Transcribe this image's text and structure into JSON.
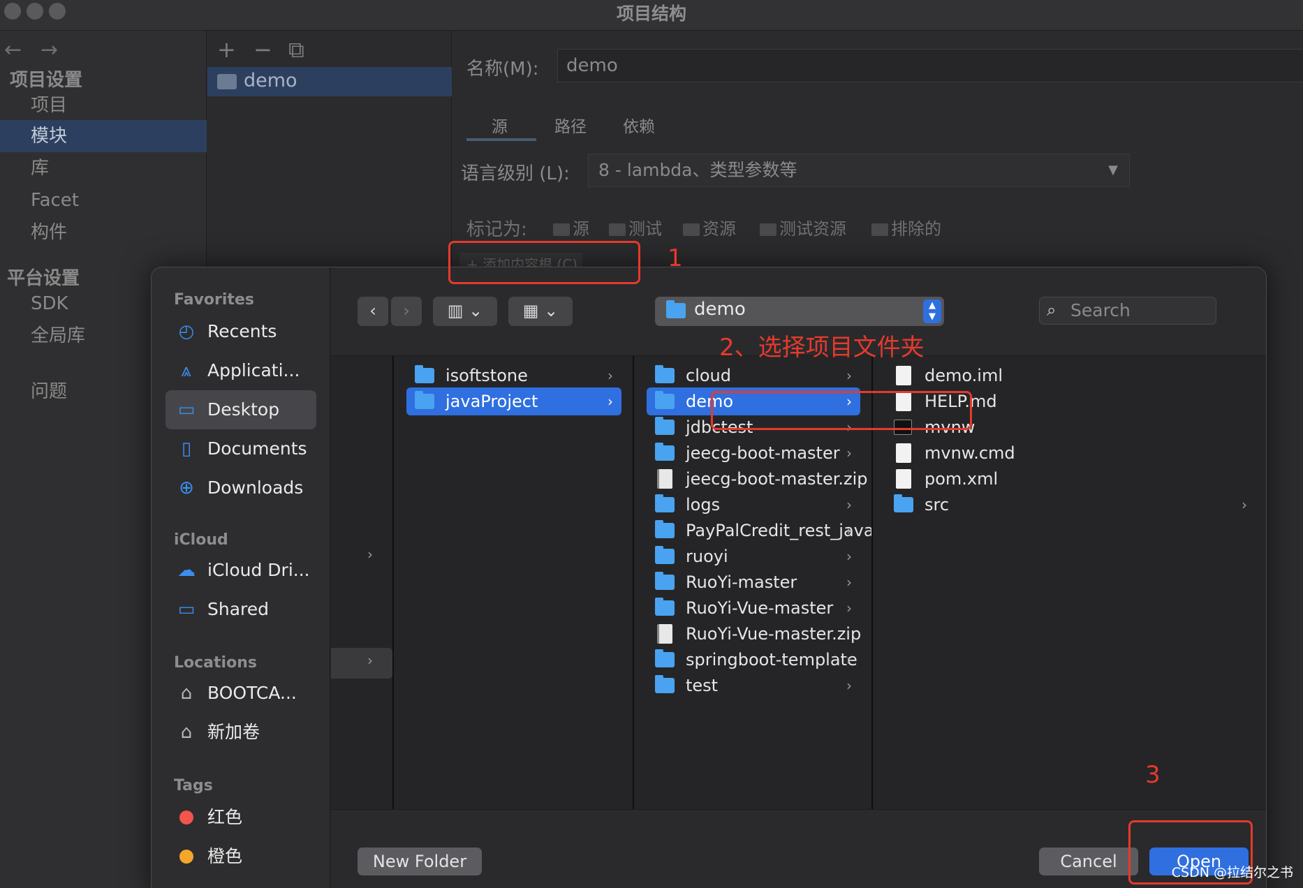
{
  "window": {
    "title": "项目结构"
  },
  "ide_sidebar": {
    "back": "←",
    "forward": "→",
    "project_settings": "项目设置",
    "project_items": [
      "项目",
      "模块",
      "库",
      "Facet",
      "构件"
    ],
    "platform_settings": "平台设置",
    "platform_items": [
      "SDK",
      "全局库"
    ],
    "problems": "问题"
  },
  "module_list": {
    "add": "+",
    "remove": "−",
    "copy": "⧉",
    "module_name": "demo"
  },
  "module_settings": {
    "name_label": "名称(M):",
    "name_value": "demo",
    "tabs": [
      "源",
      "路径",
      "依赖"
    ],
    "lang_label": "语言级别 (L):",
    "lang_value": "8 - lambda、类型参数等",
    "mark_label": "标记为:",
    "marks": [
      "源",
      "测试",
      "资源",
      "测试资源",
      "排除的"
    ],
    "add_root": "+ 添加内容根 (C)"
  },
  "annotations": {
    "n1": "1",
    "n2": "2、选择项目文件夹",
    "n3": "3"
  },
  "dialog": {
    "sidebar": {
      "favorites_header": "Favorites",
      "favorites": [
        {
          "label": "Recents",
          "icon": "clock-icon"
        },
        {
          "label": "Applicati...",
          "icon": "applications-icon"
        },
        {
          "label": "Desktop",
          "icon": "desktop-icon"
        },
        {
          "label": "Documents",
          "icon": "document-icon"
        },
        {
          "label": "Downloads",
          "icon": "download-icon"
        }
      ],
      "icloud_header": "iCloud",
      "icloud": [
        {
          "label": "iCloud Dri...",
          "icon": "cloud-icon"
        },
        {
          "label": "Shared",
          "icon": "shared-folder-icon"
        }
      ],
      "locations_header": "Locations",
      "locations": [
        {
          "label": "BOOTCA...",
          "icon": "drive-icon"
        },
        {
          "label": "新加卷",
          "icon": "drive-icon"
        }
      ],
      "tags_header": "Tags",
      "tags": [
        {
          "label": "红色",
          "color": "#f2554b"
        },
        {
          "label": "橙色",
          "color": "#f4a62a"
        }
      ]
    },
    "toolbar": {
      "back": "‹",
      "forward": "›",
      "view_columns": "▥ ⌄",
      "view_grid": "▦ ⌄",
      "path": "demo",
      "search_placeholder": "Search"
    },
    "columns": {
      "col1": [
        {
          "name": "isoftstone",
          "kind": "folder"
        },
        {
          "name": "javaProject",
          "kind": "folder"
        }
      ],
      "col2": [
        {
          "name": "cloud",
          "kind": "folder"
        },
        {
          "name": "demo",
          "kind": "folder"
        },
        {
          "name": "jdbctest",
          "kind": "folder"
        },
        {
          "name": "jeecg-boot-master",
          "kind": "folder"
        },
        {
          "name": "jeecg-boot-master.zip",
          "kind": "zip"
        },
        {
          "name": "logs",
          "kind": "folder"
        },
        {
          "name": "PayPalCredit_rest_java",
          "kind": "folder"
        },
        {
          "name": "ruoyi",
          "kind": "folder"
        },
        {
          "name": "RuoYi-master",
          "kind": "folder"
        },
        {
          "name": "RuoYi-Vue-master",
          "kind": "folder"
        },
        {
          "name": "RuoYi-Vue-master.zip",
          "kind": "zip"
        },
        {
          "name": "springboot-template",
          "kind": "folder"
        },
        {
          "name": "test",
          "kind": "folder"
        }
      ],
      "col3": [
        {
          "name": "demo.iml",
          "kind": "file"
        },
        {
          "name": "HELP.md",
          "kind": "file"
        },
        {
          "name": "mvnw",
          "kind": "exec"
        },
        {
          "name": "mvnw.cmd",
          "kind": "file"
        },
        {
          "name": "pom.xml",
          "kind": "file"
        },
        {
          "name": "src",
          "kind": "folder"
        }
      ]
    },
    "footer": {
      "new_folder": "New Folder",
      "cancel": "Cancel",
      "open": "Open"
    }
  },
  "watermark": "CSDN @拉结尔之书"
}
